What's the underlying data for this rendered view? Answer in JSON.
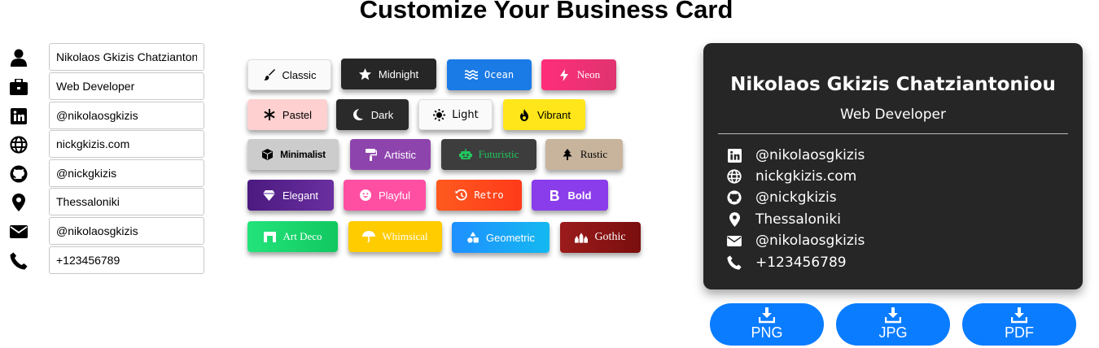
{
  "page": {
    "title": "Customize Your Business Card"
  },
  "form": {
    "name": "Nikolaos Gkizis Chatziantoniou",
    "job": "Web Developer",
    "linkedin": "@nikolaosgkizis",
    "website": "nickgkizis.com",
    "github": "@nickgkizis",
    "location": "Thessaloniki",
    "email": "@nikolaosgkizis",
    "phone": "+123456789"
  },
  "themes": {
    "classic": "Classic",
    "midnight": "Midnight",
    "ocean": "Ocean",
    "neon": "Neon",
    "pastel": "Pastel",
    "dark": "Dark",
    "light": "Light",
    "vibrant": "Vibrant",
    "minimalist": "Minimalist",
    "artistic": "Artistic",
    "futuristic": "Futuristic",
    "rustic": "Rustic",
    "elegant": "Elegant",
    "playful": "Playful",
    "retro": "Retro",
    "bold": "Bold",
    "artdeco": "Art Deco",
    "whimsical": "Whimsical",
    "geometric": "Geometric",
    "gothic": "Gothic"
  },
  "card": {
    "name": "Nikolaos Gkizis Chatziantoniou",
    "job": "Web Developer",
    "linkedin": "@nikolaosgkizis",
    "website": "nickgkizis.com",
    "github": "@nickgkizis",
    "location": "Thessaloniki",
    "email": "@nikolaosgkizis",
    "phone": "+123456789"
  },
  "download": {
    "png": "PNG",
    "jpg": "JPG",
    "pdf": "PDF"
  },
  "colors": {
    "card_bg": "#262626",
    "download_btn": "#0a7cff"
  }
}
